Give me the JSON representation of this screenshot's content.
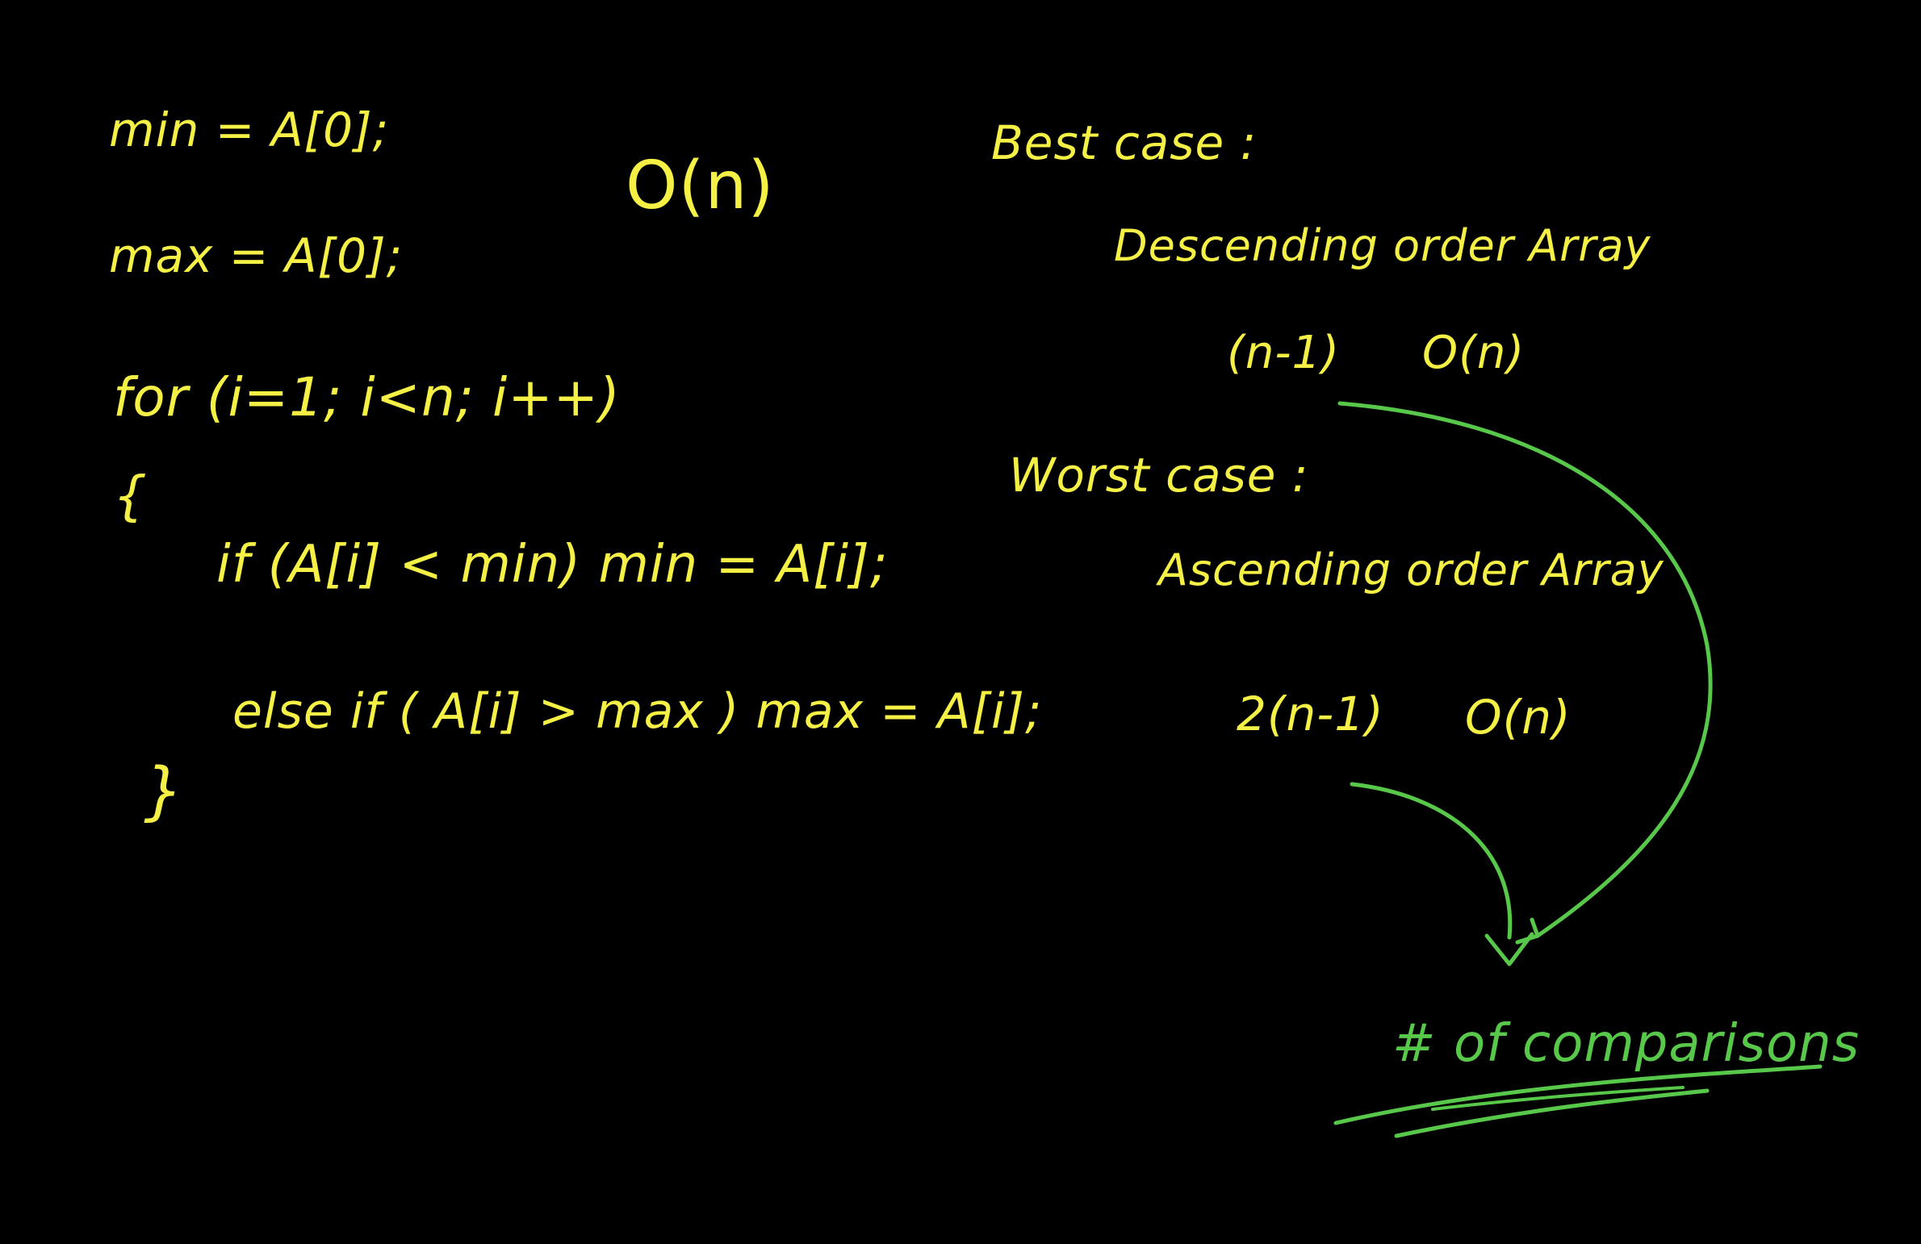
{
  "colors": {
    "background": "#000000",
    "chalk_yellow": "#f5f045",
    "chalk_green": "#58c84a"
  },
  "code": {
    "line_min_init": "min = A[0];",
    "line_max_init": "max = A[0];",
    "line_for": "for (i=1; i<n; i++)",
    "line_open_brace": "{",
    "line_if": "if (A[i] < min)  min = A[i];",
    "line_else_if": "else if ( A[i] > max )  max = A[i];",
    "line_close_brace": "}"
  },
  "complexity_main": "O(n)",
  "cases": {
    "best_title": "Best case :",
    "best_desc": "Descending order Array",
    "best_count": "(n-1)",
    "best_order": "O(n)",
    "worst_title": "Worst case :",
    "worst_desc": "Ascending order Array",
    "worst_count": "2(n-1)",
    "worst_order": "O(n)"
  },
  "footer_label": "# of comparisons"
}
